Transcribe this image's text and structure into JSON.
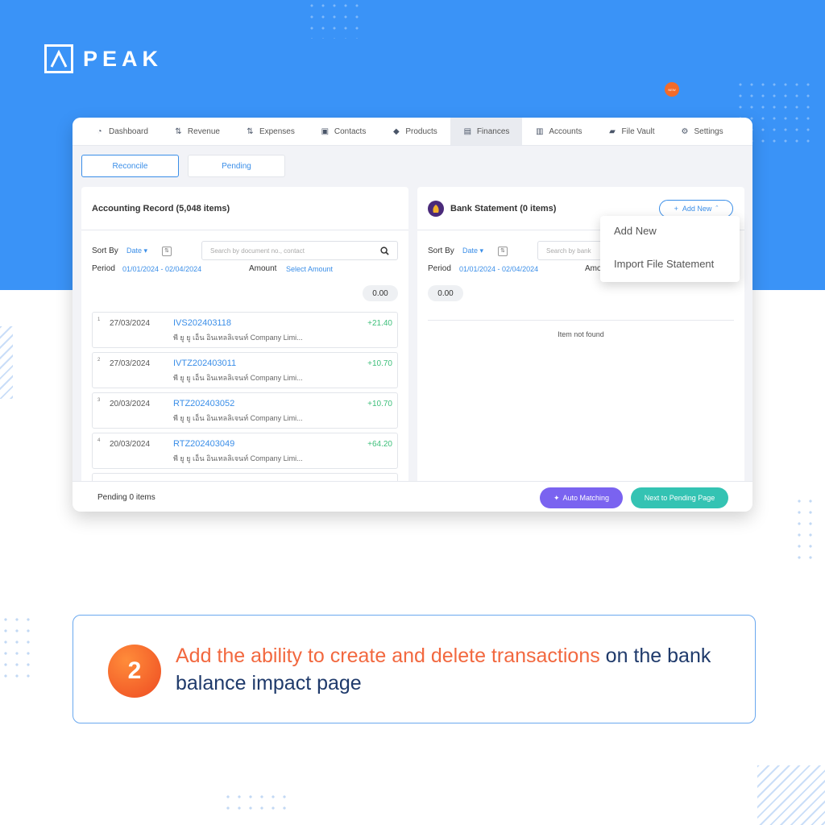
{
  "brand": {
    "name": "PEAK"
  },
  "nav": {
    "items": [
      {
        "label": "Dashboard",
        "icon": "dashboard-icon"
      },
      {
        "label": "Revenue",
        "icon": "revenue-icon"
      },
      {
        "label": "Expenses",
        "icon": "expenses-icon"
      },
      {
        "label": "Contacts",
        "icon": "contacts-icon"
      },
      {
        "label": "Products",
        "icon": "products-icon"
      },
      {
        "label": "Finances",
        "icon": "finances-icon",
        "active": true
      },
      {
        "label": "Accounts",
        "icon": "accounts-icon"
      },
      {
        "label": "File Vault",
        "icon": "folder-icon"
      },
      {
        "label": "Settings",
        "icon": "gear-icon"
      }
    ]
  },
  "tabs": {
    "reconcile": "Reconcile",
    "pending": "Pending"
  },
  "left_panel": {
    "title": "Accounting Record (5,048 items)",
    "sort_label": "Sort By",
    "sort_value": "Date",
    "search_placeholder": "Search by document no., contact",
    "period_label": "Period",
    "period_value": "01/01/2024 - 02/04/2024",
    "amount_label": "Amount",
    "amount_value": "Select Amount",
    "total": "0.00",
    "records": [
      {
        "num": "1",
        "date": "27/03/2024",
        "doc": "IVS202403118",
        "contact": "พี ยู ยู เอ็น อินเทลลิเจนท์ Company Limi...",
        "amount": "+21.40"
      },
      {
        "num": "2",
        "date": "27/03/2024",
        "doc": "IVTZ202403011",
        "contact": "พี ยู ยู เอ็น อินเทลลิเจนท์ Company Limi...",
        "amount": "+10.70"
      },
      {
        "num": "3",
        "date": "20/03/2024",
        "doc": "RTZ202403052",
        "contact": "พี ยู ยู เอ็น อินเทลลิเจนท์ Company Limi...",
        "amount": "+10.70"
      },
      {
        "num": "4",
        "date": "20/03/2024",
        "doc": "RTZ202403049",
        "contact": "พี ยู ยู เอ็น อินเทลลิเจนท์ Company Limi...",
        "amount": "+64.20"
      }
    ]
  },
  "right_panel": {
    "title": "Bank Statement (0 items)",
    "add_new_label": "Add New",
    "new_badge": "NEW",
    "sort_label": "Sort By",
    "sort_value": "Date",
    "search_placeholder": "Search by bank",
    "period_label": "Period",
    "period_value": "01/01/2024 - 02/04/2024",
    "amount_label": "Amo",
    "total": "0.00",
    "empty_text": "Item not found"
  },
  "dropdown": {
    "items": [
      "Add New",
      "Import File Statement"
    ]
  },
  "footer": {
    "pending_text": "Pending 0 items",
    "auto_matching": "Auto Matching",
    "next_page": "Next to Pending Page"
  },
  "callout": {
    "step": "2",
    "highlight": "Add the ability to create and delete transactions",
    "rest": " on the bank balance impact page"
  },
  "colors": {
    "hero_bg": "#3a93f7",
    "link_blue": "#3a8ee8",
    "positive_green": "#3dbf7a",
    "auto_btn": "#7a63f0",
    "next_btn": "#34c3b3",
    "accent_orange": "#f2683f"
  }
}
